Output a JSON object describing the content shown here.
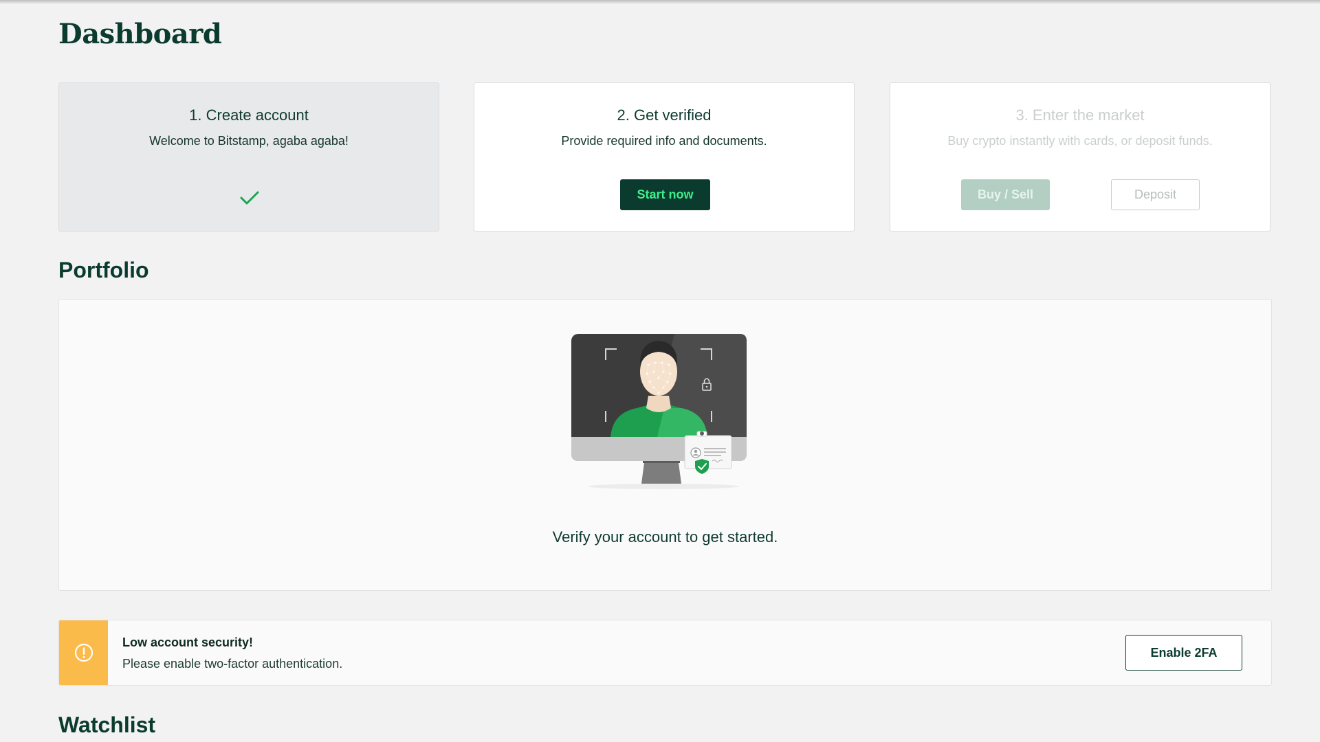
{
  "page": {
    "title": "Dashboard"
  },
  "steps": [
    {
      "title": "1. Create account",
      "subtitle": "Welcome to Bitstamp, agaba agaba!",
      "status": "completed",
      "icon": "check-icon"
    },
    {
      "title": "2. Get verified",
      "subtitle": "Provide required info and documents.",
      "button": "Start now"
    },
    {
      "title": "3. Enter the market",
      "subtitle": "Buy crypto instantly with cards, or deposit funds.",
      "buttons": {
        "buy_sell": "Buy / Sell",
        "deposit": "Deposit"
      },
      "status": "disabled"
    }
  ],
  "portfolio": {
    "title": "Portfolio",
    "illustration": "face-verification-illustration",
    "message": "Verify your account to get started."
  },
  "security_alert": {
    "icon": "warning-circle-icon",
    "title": "Low account security!",
    "message": "Please enable two-factor authentication.",
    "button": "Enable 2FA"
  },
  "watchlist": {
    "title": "Watchlist"
  },
  "colors": {
    "brand_dark": "#0b3b2e",
    "brand_green": "#3ff08a",
    "check_green": "#1aa454",
    "warning": "#fbbb4a",
    "background": "#f2f2f2"
  }
}
